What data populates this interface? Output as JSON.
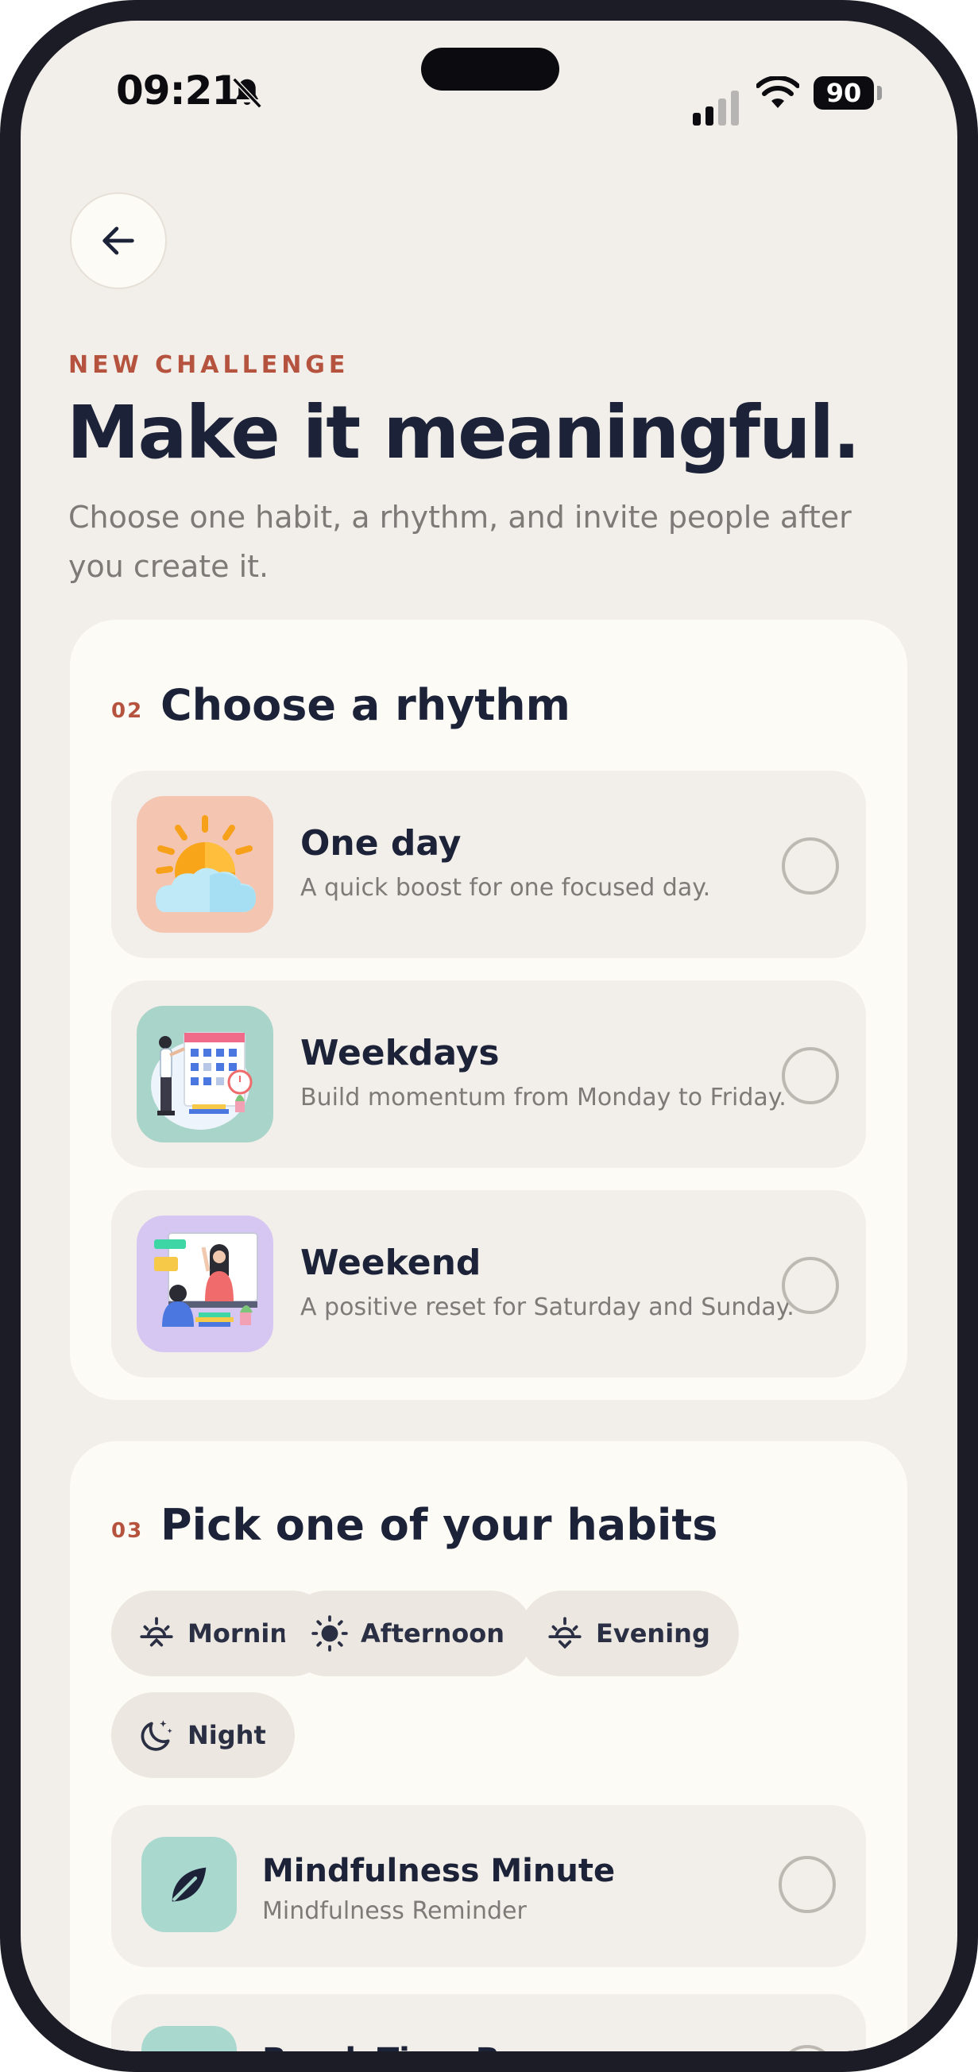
{
  "status_bar": {
    "time": "09:21",
    "battery": "90"
  },
  "header": {
    "eyebrow": "NEW CHALLENGE",
    "title": "Make it meaningful.",
    "subtitle": "Choose one habit, a rhythm, and invite people after you create it."
  },
  "rhythm_section": {
    "step": "02",
    "title": "Choose a rhythm",
    "options": [
      {
        "title": "One day",
        "description": "A quick boost for one focused day.",
        "icon": "sun-cloud-illustration",
        "selected": false
      },
      {
        "title": "Weekdays",
        "description": "Build momentum from Monday to Friday.",
        "icon": "calendar-planner-illustration",
        "selected": false
      },
      {
        "title": "Weekend",
        "description": "A positive reset for Saturday and Sunday.",
        "icon": "video-call-illustration",
        "selected": false
      }
    ]
  },
  "habits_section": {
    "step": "03",
    "title": "Pick one of your habits",
    "filters": [
      {
        "label": "Morning",
        "icon": "sunrise-icon"
      },
      {
        "label": "Afternoon",
        "icon": "sun-icon"
      },
      {
        "label": "Evening",
        "icon": "sunset-icon"
      },
      {
        "label": "Night",
        "icon": "moon-stars-icon"
      }
    ],
    "habits": [
      {
        "title": "Mindfulness Minute",
        "subtitle": "Mindfulness Reminder",
        "icon": "leaf-icon",
        "selected": false
      },
      {
        "title": "Break Time Boss",
        "subtitle": "",
        "icon": "leaf-icon",
        "selected": false
      }
    ]
  },
  "colors": {
    "background": "#f2eee9",
    "card": "#fdfbf6",
    "accent": "#b5533f",
    "text_primary": "#1c2238",
    "text_secondary": "#7f7a78",
    "habit_icon_bg": "#a9d8cf"
  }
}
